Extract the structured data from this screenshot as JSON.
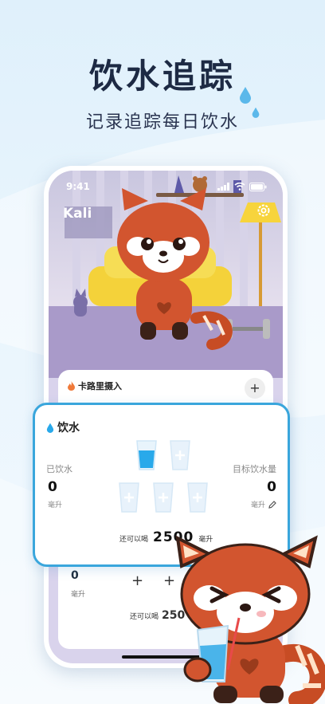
{
  "hero": {
    "title": "饮水追踪",
    "subtitle": "记录追踪每日饮水"
  },
  "status_bar": {
    "time": "9:41"
  },
  "app": {
    "user_name": "Kali"
  },
  "calorie_card": {
    "title": "卡路里摄入",
    "add_label": "+"
  },
  "water_card": {
    "title": "饮水",
    "drunk_label": "已饮水",
    "drunk_value": "0",
    "drunk_unit": "毫升",
    "goal_label": "目标饮水量",
    "goal_value": "0",
    "goal_unit": "毫升",
    "remaining_prefix": "还可以喝",
    "remaining_value": "2500",
    "remaining_unit": "毫升",
    "cups": [
      {
        "state": "filled"
      },
      {
        "state": "empty"
      },
      {
        "state": "empty"
      },
      {
        "state": "empty"
      },
      {
        "state": "empty"
      }
    ]
  },
  "lower_card": {
    "drunk_value": "0",
    "unit": "毫升",
    "add_label": "+",
    "remaining_prefix": "还可以喝",
    "remaining_value": "250"
  },
  "colors": {
    "accent": "#3aa6dc",
    "water": "#29a9ea",
    "panda": "#d2552f",
    "title": "#1d2a44"
  }
}
